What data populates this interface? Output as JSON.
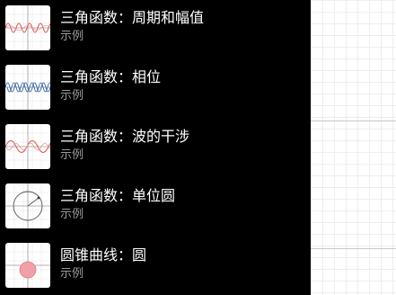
{
  "menu": {
    "items": [
      {
        "title": "三角函数：周期和幅值",
        "subtitle": "示例"
      },
      {
        "title": "三角函数：相位",
        "subtitle": "示例"
      },
      {
        "title": "三角函数：波的干涉",
        "subtitle": "示例"
      },
      {
        "title": "三角函数：单位圆",
        "subtitle": "示例"
      },
      {
        "title": "圆锥曲线：圆",
        "subtitle": "示例"
      }
    ]
  },
  "colors": {
    "drawer_background": "#000000",
    "title_text": "#ffffff",
    "subtitle_text": "#9a9a9a",
    "curve_red": "#d9534f",
    "curve_blue": "#3b6fb6",
    "circle_fill": "#f0a0a8"
  },
  "icons": [
    "sine-wave-thumbnail",
    "phase-wave-thumbnail",
    "interference-wave-thumbnail",
    "unit-circle-thumbnail",
    "circle-conic-thumbnail"
  ]
}
